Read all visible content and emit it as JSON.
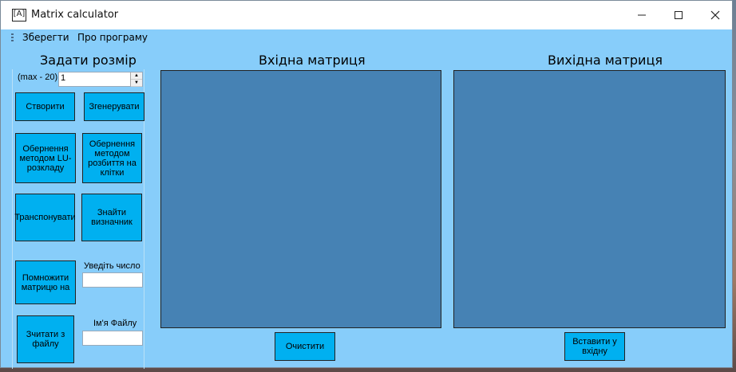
{
  "window": {
    "title": "Matrix calculator",
    "app_icon": "[A]",
    "controls": {
      "minimize": "minimize-icon",
      "maximize": "maximize-icon",
      "close": "close-icon"
    }
  },
  "menu": {
    "items": [
      "Зберегти",
      "Про програму"
    ]
  },
  "left": {
    "size_heading": "Задати розмір",
    "size_label": "(max - 20)",
    "size_value": "1",
    "create_button": "Створити",
    "generate_button": "Згенерувати",
    "inverse_lu_button": "Обернення методом LU-розкладу",
    "inverse_block_button": "Обернення методом розбиття на клітки",
    "transpose_button": "Транспонувати",
    "determinant_button": "Знайти визначник",
    "multiply_button": "Помножити матрицю на",
    "number_label": "Уведіть число",
    "number_value": "",
    "read_file_button": "Зчитати з файлу",
    "filename_label": "Ім'я Файлу",
    "filename_value": ""
  },
  "input_matrix": {
    "heading": "Вхідна матриця",
    "clear_button": "Очистити"
  },
  "output_matrix": {
    "heading": "Вихідна матриця",
    "insert_button": "Вставити у вхідну"
  },
  "colors": {
    "background": "#87cdfa",
    "button": "#00b0f0",
    "matrix": "#4682b4"
  }
}
